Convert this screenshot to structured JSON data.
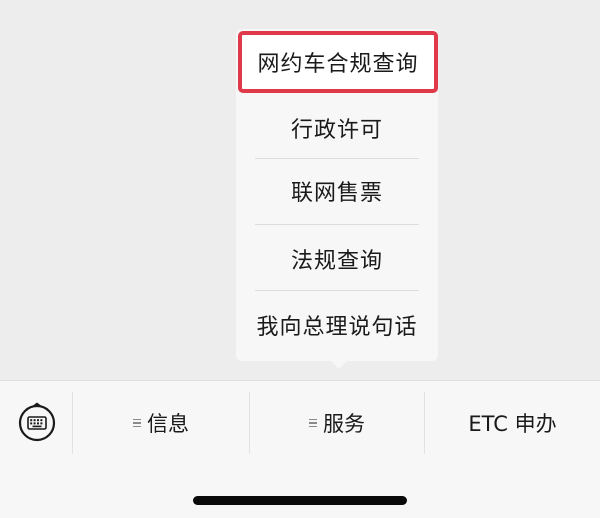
{
  "popup_menu": {
    "items": [
      {
        "label": "网约车合规查询",
        "highlighted": true
      },
      {
        "label": "行政许可",
        "highlighted": false
      },
      {
        "label": "联网售票",
        "highlighted": false
      },
      {
        "label": "法规查询",
        "highlighted": false
      },
      {
        "label": "我向总理说句话",
        "highlighted": false
      }
    ],
    "highlight_color": "#e03a4a"
  },
  "bottom_bar": {
    "keyboard_icon": "keyboard-icon",
    "tabs": [
      {
        "label": "信息",
        "has_menu_glyph": true
      },
      {
        "label": "服务",
        "has_menu_glyph": true
      },
      {
        "label": "ETC 申办",
        "has_menu_glyph": false
      }
    ]
  }
}
